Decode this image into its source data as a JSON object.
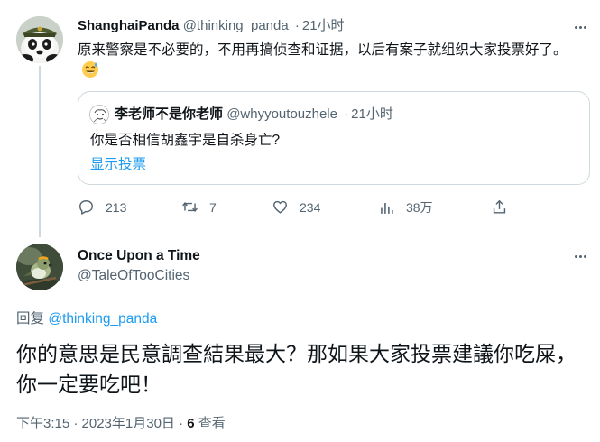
{
  "tweet1": {
    "author_name": "ShanghaiPanda",
    "author_handle": "@thinking_panda",
    "separator": "·",
    "time": "21小时",
    "text": "原来警察是不必要的，不用再搞侦查和证据，以后有案子就组织大家投票好了。",
    "emoji": "sweat-smile-emoji",
    "quote": {
      "author_name": "李老师不是你老师",
      "author_handle": "@whyyoutouzhele",
      "separator": "·",
      "time": "21小时",
      "text": "你是否相信胡鑫宇是自杀身亡?",
      "link": "显示投票"
    },
    "actions": {
      "replies": "213",
      "retweets": "7",
      "likes": "234",
      "views": "38万"
    }
  },
  "tweet2": {
    "author_name": "Once Upon a Time",
    "author_handle": "@TaleOfTooCities",
    "reply_prefix": "回复",
    "reply_to": "@thinking_panda",
    "text": "你的意思是民意調查結果最大？那如果大家投票建議你吃屎，你一定要吃吧！",
    "timestamp": "下午3:15 · 2023年1月30日 · ",
    "views_count": "6",
    "views_label": "查看"
  },
  "colors": {
    "text": "#0f1419",
    "secondary": "#536471",
    "link": "#1d9bf0",
    "border": "#cfd9de"
  }
}
